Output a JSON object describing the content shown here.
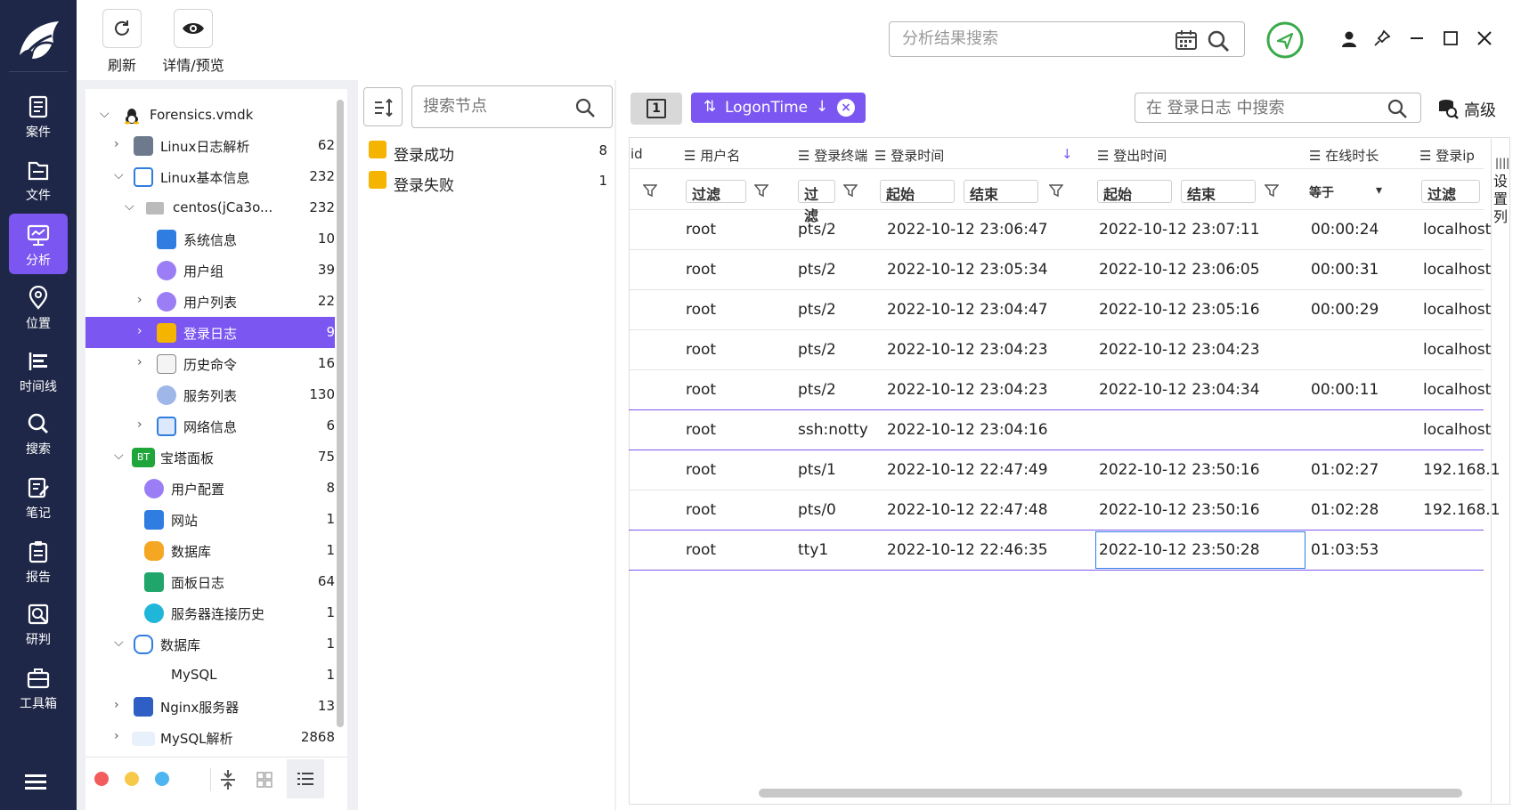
{
  "nav": {
    "items": [
      {
        "label": "案件",
        "icon": "case-icon"
      },
      {
        "label": "文件",
        "icon": "file-icon"
      },
      {
        "label": "分析",
        "icon": "analysis-icon"
      },
      {
        "label": "位置",
        "icon": "location-icon"
      },
      {
        "label": "时间线",
        "icon": "timeline-icon"
      },
      {
        "label": "搜索",
        "icon": "search-icon"
      },
      {
        "label": "笔记",
        "icon": "note-icon"
      },
      {
        "label": "报告",
        "icon": "report-icon"
      },
      {
        "label": "研判",
        "icon": "judge-icon"
      },
      {
        "label": "工具箱",
        "icon": "toolbox-icon"
      }
    ],
    "active": "分析"
  },
  "toolbar": {
    "refresh_label": "刷新",
    "detail_label": "详情/预览"
  },
  "search": {
    "placeholder": "分析结果搜索"
  },
  "tree": {
    "root": "Forensics.vmdk",
    "nodes": [
      {
        "label": "Linux日志解析",
        "count": "62"
      },
      {
        "label": "Linux基本信息",
        "count": "232"
      },
      {
        "label": "centos(jCa3o...",
        "count": "232"
      },
      {
        "label": "系统信息",
        "count": "10"
      },
      {
        "label": "用户组",
        "count": "39"
      },
      {
        "label": "用户列表",
        "count": "22"
      },
      {
        "label": "登录日志",
        "count": "9"
      },
      {
        "label": "历史命令",
        "count": "16"
      },
      {
        "label": "服务列表",
        "count": "130"
      },
      {
        "label": "网络信息",
        "count": "6"
      },
      {
        "label": "宝塔面板",
        "count": "75"
      },
      {
        "label": "用户配置",
        "count": "8"
      },
      {
        "label": "网站",
        "count": "1"
      },
      {
        "label": "数据库",
        "count": "1"
      },
      {
        "label": "面板日志",
        "count": "64"
      },
      {
        "label": "服务器连接历史",
        "count": "1"
      },
      {
        "label": "数据库",
        "count": "1"
      },
      {
        "label": "MySQL",
        "count": "1"
      },
      {
        "label": "Nginx服务器",
        "count": "13"
      },
      {
        "label": "MySQL解析",
        "count": "2868"
      }
    ],
    "bt_badge": "BT"
  },
  "mid": {
    "search_placeholder": "搜索节点",
    "items": [
      {
        "label": "登录成功",
        "count": "8"
      },
      {
        "label": "登录失败",
        "count": "1"
      }
    ]
  },
  "table": {
    "page_num": "1",
    "sort_chip": "LogonTime",
    "search_placeholder": "在 登录日志 中搜索",
    "advanced_label": "高级",
    "column_settings": "设置列",
    "columns": [
      "id",
      "用户名",
      "登录终端",
      "登录时间",
      "登出时间",
      "在线时长",
      "登录ip"
    ],
    "filters": {
      "filter": "过滤",
      "start": "起始",
      "end": "结束",
      "equals": "等于"
    },
    "rows": [
      [
        "root",
        "pts/2",
        "2022-10-12 23:06:47",
        "2022-10-12 23:07:11",
        "00:00:24",
        "localhost"
      ],
      [
        "root",
        "pts/2",
        "2022-10-12 23:05:34",
        "2022-10-12 23:06:05",
        "00:00:31",
        "localhost"
      ],
      [
        "root",
        "pts/2",
        "2022-10-12 23:04:47",
        "2022-10-12 23:05:16",
        "00:00:29",
        "localhost"
      ],
      [
        "root",
        "pts/2",
        "2022-10-12 23:04:23",
        "2022-10-12 23:04:23",
        "",
        "localhost"
      ],
      [
        "root",
        "pts/2",
        "2022-10-12 23:04:23",
        "2022-10-12 23:04:34",
        "00:00:11",
        "localhost"
      ],
      [
        "root",
        "ssh:notty",
        "2022-10-12 23:04:16",
        "",
        "",
        "localhost"
      ],
      [
        "root",
        "pts/1",
        "2022-10-12 22:47:49",
        "2022-10-12 23:50:16",
        "01:02:27",
        "192.168.1"
      ],
      [
        "root",
        "pts/0",
        "2022-10-12 22:47:48",
        "2022-10-12 23:50:16",
        "01:02:28",
        "192.168.1"
      ],
      [
        "root",
        "tty1",
        "2022-10-12 22:46:35",
        "2022-10-12 23:50:28",
        "01:03:53",
        ""
      ]
    ]
  },
  "colors": {
    "accent": "#7b56f0",
    "nav_bg": "#1f2748",
    "pin_green": "#3aaa4a"
  }
}
